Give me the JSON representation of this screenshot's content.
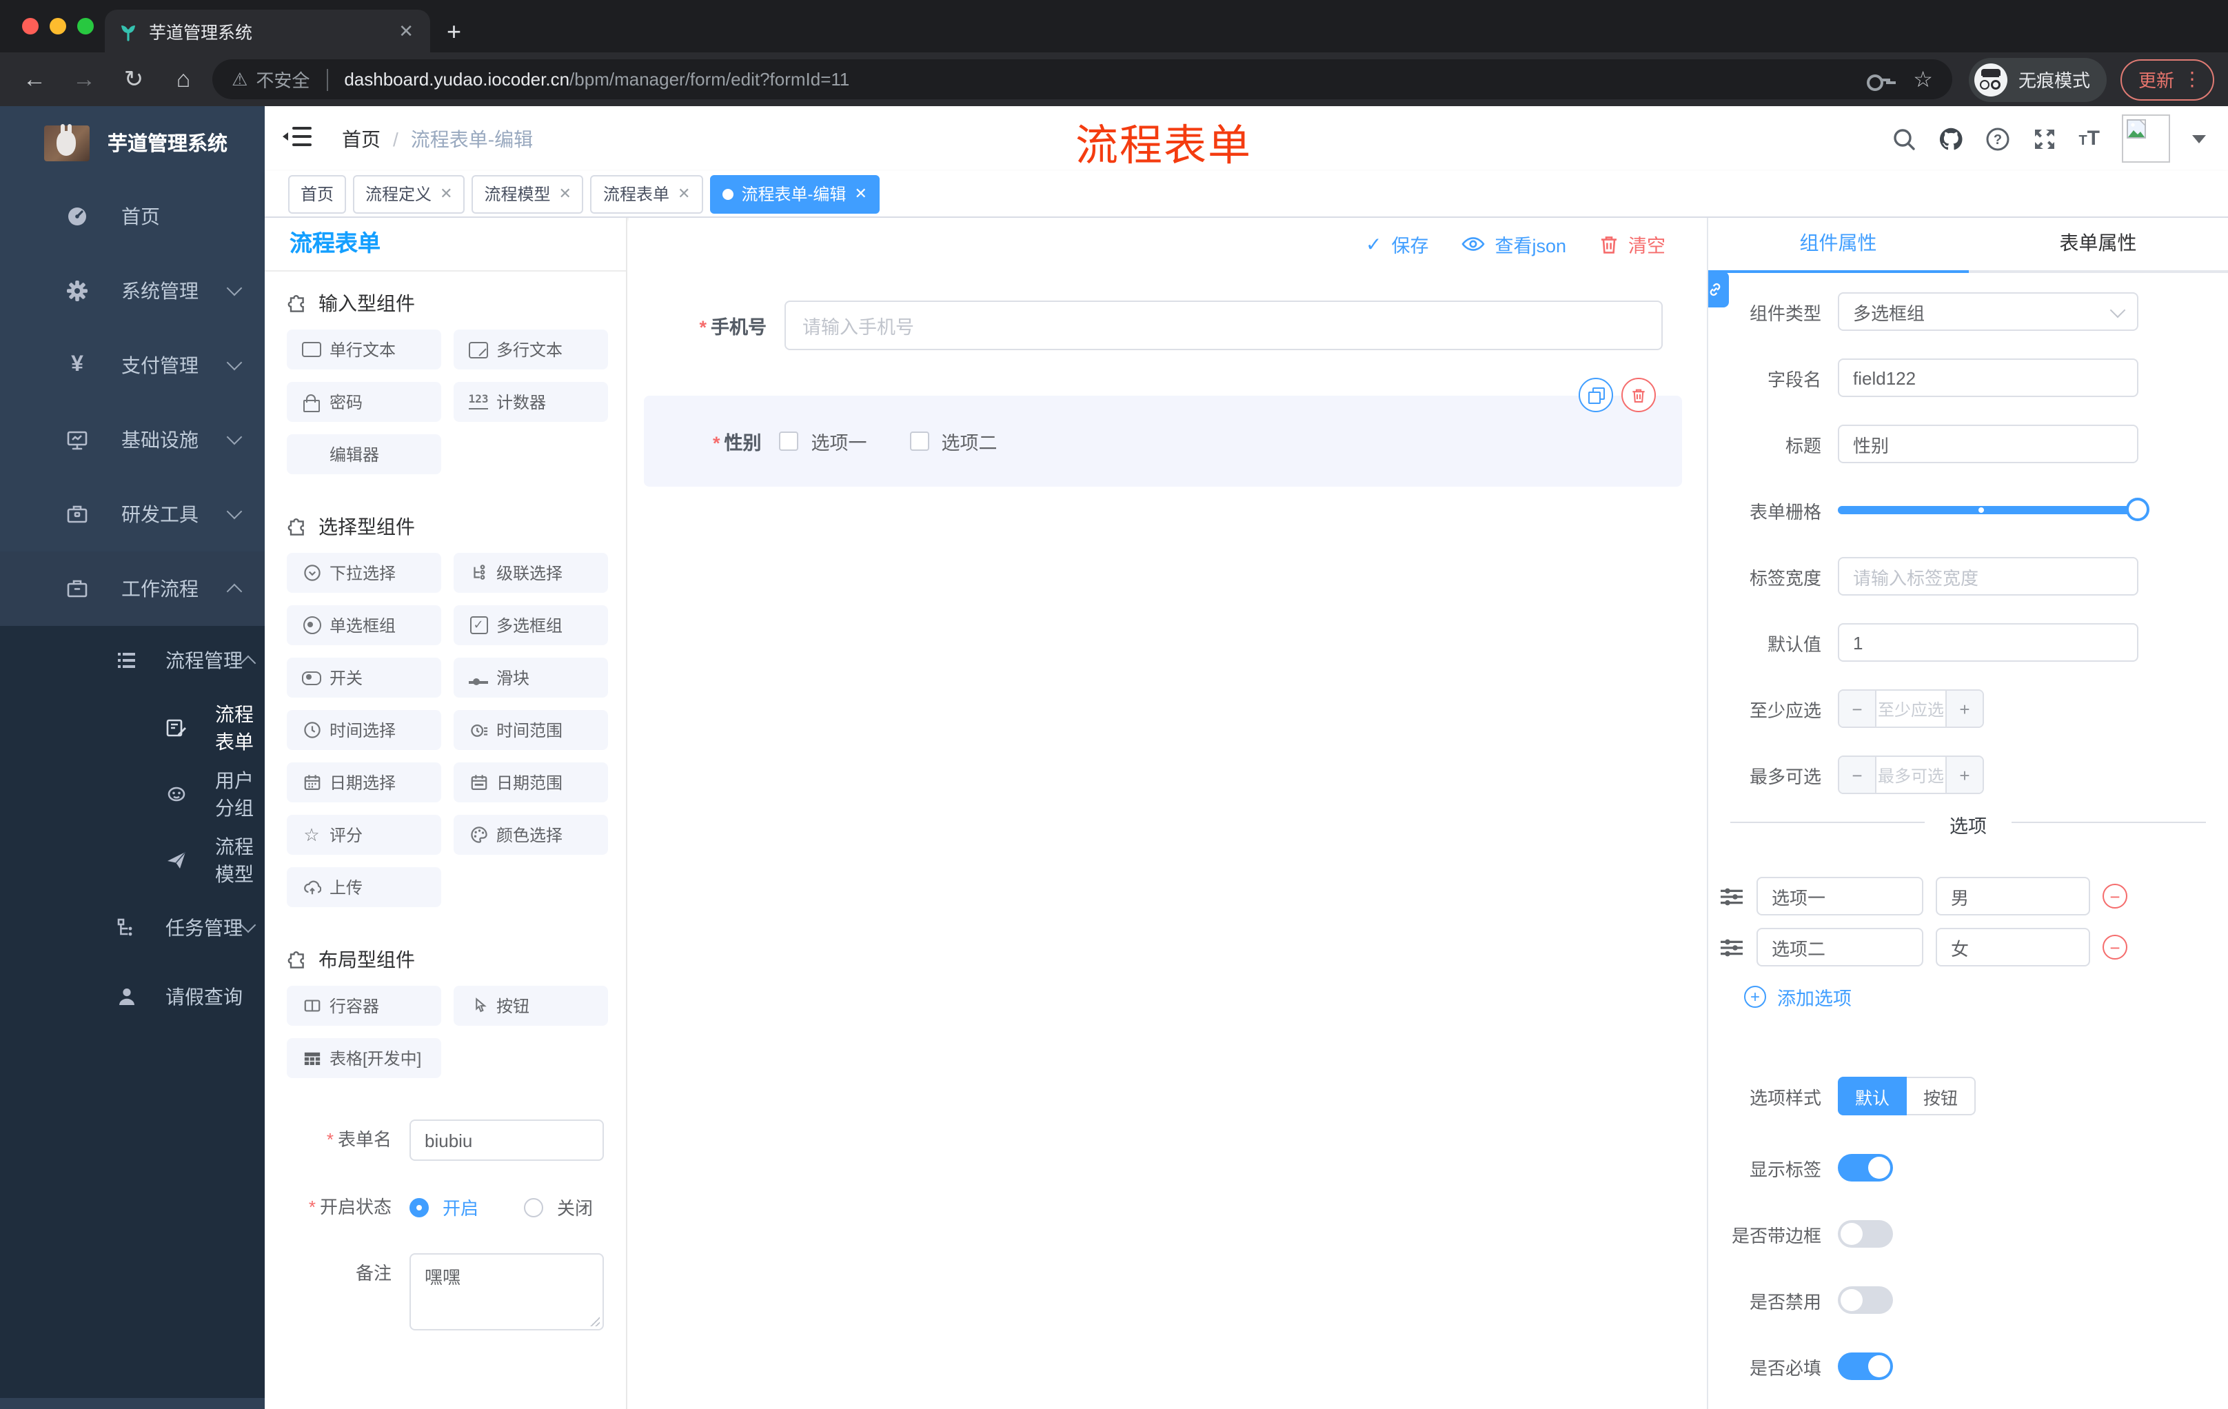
{
  "browser": {
    "tab_title": "芋道管理系统",
    "new_tab_plus": "+",
    "insecure": "不安全",
    "url_host": "dashboard.yudao.iocoder.cn",
    "url_path": "/bpm/manager/form/edit?formId=11",
    "incognito": "无痕模式",
    "update": "更新"
  },
  "sidebar": {
    "logo_title": "芋道管理系统",
    "items": [
      {
        "label": "首页"
      },
      {
        "label": "系统管理"
      },
      {
        "label": "支付管理"
      },
      {
        "label": "基础设施"
      },
      {
        "label": "研发工具"
      },
      {
        "label": "工作流程"
      }
    ],
    "submenu": {
      "label": "流程管理",
      "children": [
        {
          "label": "流程表单"
        },
        {
          "label": "用户分组"
        },
        {
          "label": "流程模型"
        }
      ]
    },
    "extra": [
      {
        "label": "任务管理"
      },
      {
        "label": "请假查询"
      }
    ]
  },
  "header": {
    "breadcrumb_home": "首页",
    "breadcrumb_current": "流程表单-编辑",
    "annotation": "流程表单"
  },
  "tagbar": {
    "tabs": [
      {
        "label": "首页"
      },
      {
        "label": "流程定义"
      },
      {
        "label": "流程模型"
      },
      {
        "label": "流程表单"
      },
      {
        "label": "流程表单-编辑"
      }
    ]
  },
  "palette": {
    "title": "流程表单",
    "groups": [
      {
        "title": "输入型组件",
        "items": [
          "单行文本",
          "多行文本",
          "密码",
          "计数器",
          "编辑器"
        ]
      },
      {
        "title": "选择型组件",
        "items": [
          "下拉选择",
          "级联选择",
          "单选框组",
          "多选框组",
          "开关",
          "滑块",
          "时间选择",
          "时间范围",
          "日期选择",
          "日期范围",
          "评分",
          "颜色选择",
          "上传"
        ]
      },
      {
        "title": "布局型组件",
        "items": [
          "行容器",
          "按钮",
          "表格[开发中]"
        ]
      }
    ],
    "form": {
      "name_label": "表单名",
      "name_value": "biubiu",
      "status_label": "开启状态",
      "status_on": "开启",
      "status_off": "关闭",
      "remark_label": "备注",
      "remark_value": "嘿嘿"
    }
  },
  "canvas": {
    "actions": {
      "save": "保存",
      "view_json": "查看json",
      "clear": "清空"
    },
    "phone_label": "手机号",
    "phone_placeholder": "请输入手机号",
    "gender_label": "性别",
    "gender_options": [
      "选项一",
      "选项二"
    ]
  },
  "props": {
    "tab_component": "组件属性",
    "tab_form": "表单属性",
    "component_type_label": "组件类型",
    "component_type_value": "多选框组",
    "field_name_label": "字段名",
    "field_name_value": "field122",
    "title_label": "标题",
    "title_value": "性别",
    "grid_label": "表单栅格",
    "label_width_label": "标签宽度",
    "label_width_placeholder": "请输入标签宽度",
    "default_label": "默认值",
    "default_value": "1",
    "min_label": "至少应选",
    "min_placeholder": "至少应选",
    "max_label": "最多可选",
    "max_placeholder": "最多可选",
    "options_divider": "选项",
    "options": [
      {
        "label": "选项一",
        "value": "男"
      },
      {
        "label": "选项二",
        "value": "女"
      }
    ],
    "add_option": "添加选项",
    "style_label": "选项样式",
    "style_default": "默认",
    "style_button": "按钮",
    "switch_show_label": "显示标签",
    "switch_border": "是否带边框",
    "switch_disabled": "是否禁用",
    "switch_required": "是否必填"
  },
  "colors": {
    "accent": "#409eff",
    "danger": "#f56c6c",
    "annotation": "#f43c10",
    "sidebar_bg": "#304156",
    "submenu_bg": "#1f2d3d"
  }
}
